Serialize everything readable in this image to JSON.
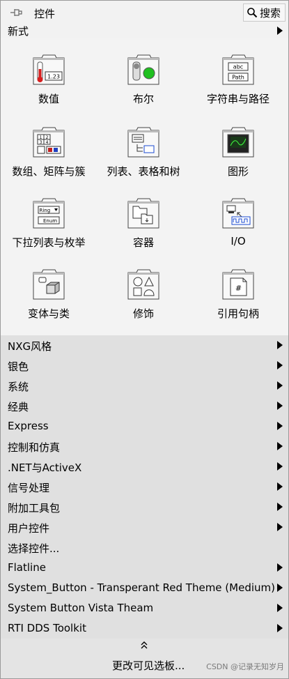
{
  "title": "控件",
  "search_label": "搜索",
  "new_style_label": "新式",
  "palette": [
    {
      "label": "数值",
      "icon": "numeric-icon"
    },
    {
      "label": "布尔",
      "icon": "boolean-icon"
    },
    {
      "label": "字符串与路径",
      "icon": "string-path-icon"
    },
    {
      "label": "数组、矩阵与簇",
      "icon": "array-matrix-cluster-icon"
    },
    {
      "label": "列表、表格和树",
      "icon": "list-table-tree-icon"
    },
    {
      "label": "图形",
      "icon": "graph-icon"
    },
    {
      "label": "下拉列表与枚举",
      "icon": "ring-enum-icon"
    },
    {
      "label": "容器",
      "icon": "containers-icon"
    },
    {
      "label": "I/O",
      "icon": "io-icon"
    },
    {
      "label": "变体与类",
      "icon": "variant-class-icon"
    },
    {
      "label": "修饰",
      "icon": "decorations-icon"
    },
    {
      "label": "引用句柄",
      "icon": "refnum-icon"
    }
  ],
  "icon_text": {
    "numeric": "1.23",
    "string_top": "abc",
    "string_bottom": "Path",
    "array": [
      "1",
      "2",
      "3",
      "4"
    ],
    "ring": "Ring",
    "enum": "Enum",
    "refnum": "#"
  },
  "menu": [
    {
      "label": "NXG风格",
      "submenu": true
    },
    {
      "label": "银色",
      "submenu": true
    },
    {
      "label": "系统",
      "submenu": true
    },
    {
      "label": "经典",
      "submenu": true
    },
    {
      "label": "Express",
      "submenu": true
    },
    {
      "label": "控制和仿真",
      "submenu": true
    },
    {
      "label": ".NET与ActiveX",
      "submenu": true
    },
    {
      "label": "信号处理",
      "submenu": true
    },
    {
      "label": "附加工具包",
      "submenu": true
    },
    {
      "label": "用户控件",
      "submenu": true
    },
    {
      "label": "选择控件...",
      "submenu": false
    },
    {
      "label": "Flatline",
      "submenu": true
    },
    {
      "label": "System_Button - Transperant Red Theme (Medium)",
      "submenu": true
    },
    {
      "label": "System Button Vista Theam",
      "submenu": true
    },
    {
      "label": "RTI DDS Toolkit",
      "submenu": true
    }
  ],
  "change_visible_label": "更改可见选板...",
  "watermark": "CSDN @记录无知岁月"
}
